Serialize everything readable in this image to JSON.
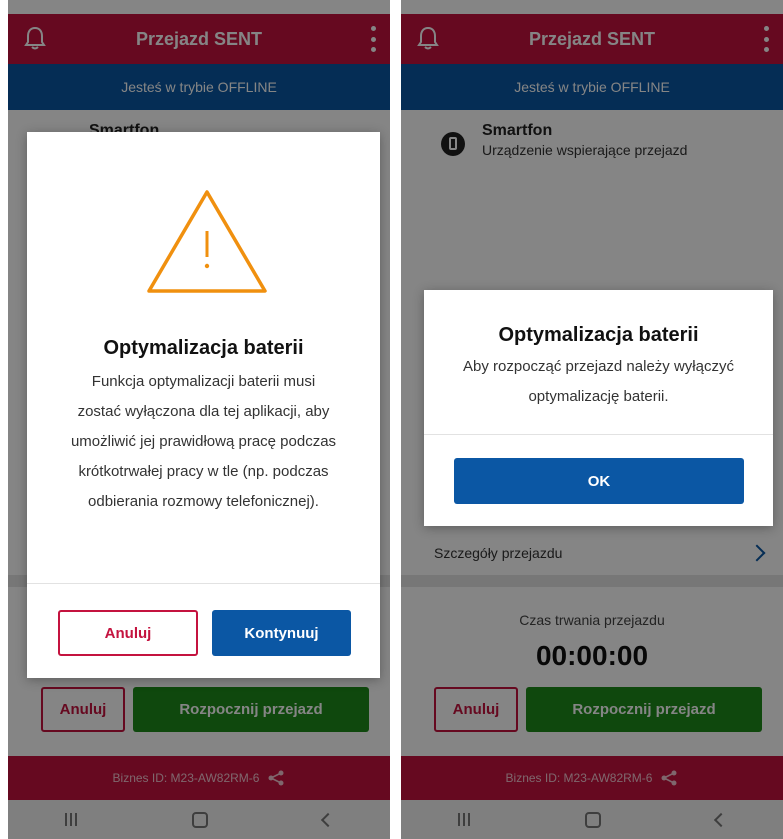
{
  "header": {
    "title": "Przejazd SENT",
    "bell_icon": "bell-icon",
    "menu_icon": "more-vertical-icon"
  },
  "offline_banner": "Jesteś w trybie OFFLINE",
  "device": {
    "icon": "smartphone-icon",
    "name": "Smartfon",
    "description": "Urządzenie wspierające przejazd"
  },
  "details_link": "Szczegóły przejazdu",
  "timer": {
    "label": "Czas trwania przejazdu",
    "value": "00:00:00"
  },
  "actions": {
    "cancel": "Anuluj",
    "start": "Rozpocznij przejazd"
  },
  "footer": {
    "business_id": "Biznes ID:  M23-AW82RM-6"
  },
  "dialog_left": {
    "icon": "warning-triangle-icon",
    "title": "Optymalizacja baterii",
    "body": [
      "Funkcja optymalizacji baterii musi",
      "zostać wyłączona dla tej aplikacji, aby",
      "umożliwić jej prawidłową pracę podczas",
      "krótkotrwałej pracy w tle (np. podczas",
      "odbierania rozmowy telefonicznej)."
    ],
    "cancel": "Anuluj",
    "continue": "Kontynuuj"
  },
  "dialog_right": {
    "title": "Optymalizacja baterii",
    "body": [
      "Aby rozpocząć przejazd należy wyłączyć",
      "optymalizację baterii."
    ],
    "ok": "OK"
  },
  "colors": {
    "brand_red": "#c4133f",
    "brand_blue": "#0b57a4",
    "start_green": "#1d8a1a",
    "warning_orange": "#f0900f"
  }
}
